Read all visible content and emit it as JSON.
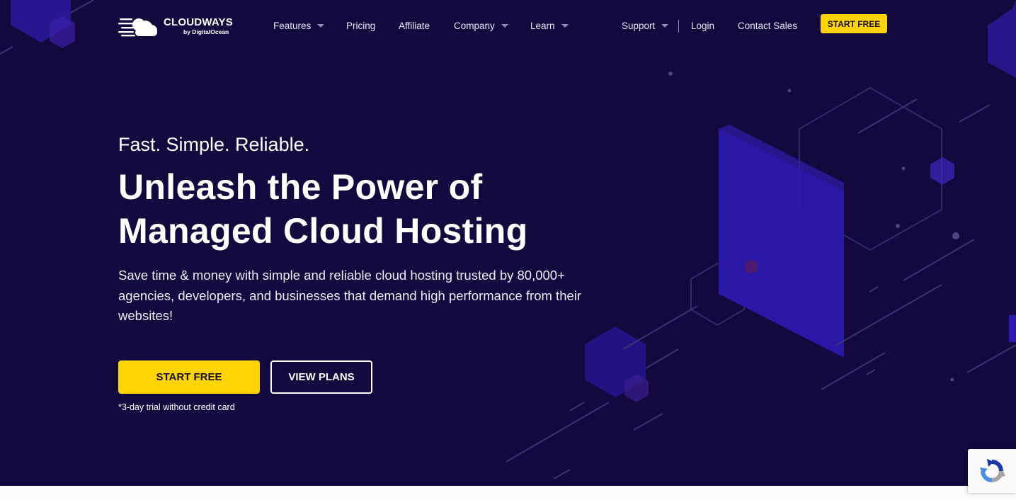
{
  "logo": {
    "brand": "CLOUDWAYS",
    "sub": "by DigitalOcean"
  },
  "nav": {
    "features": "Features",
    "pricing": "Pricing",
    "affiliate": "Affiliate",
    "company": "Company",
    "learn": "Learn",
    "support": "Support",
    "login": "Login",
    "contact_sales": "Contact Sales",
    "start_free": "START FREE"
  },
  "hero": {
    "tagline": "Fast. Simple. Reliable.",
    "headline_line1": "Unleash the Power of",
    "headline_line2": "Managed Cloud Hosting",
    "subtext": "Save time & money with simple and reliable cloud hosting trusted by 80,000+ agencies, developers, and businesses that demand high performance from their websites!",
    "primary_button": "START FREE",
    "secondary_button": "VIEW PLANS",
    "trial_note": "*3-day trial without credit card"
  },
  "colors": {
    "background": "#13093f",
    "accent": "#ffd400",
    "shape": "#2c1ab0"
  },
  "icons": {
    "logo": "cloud-icon",
    "caret": "chevron-down-icon",
    "recaptcha": "recaptcha-icon"
  }
}
